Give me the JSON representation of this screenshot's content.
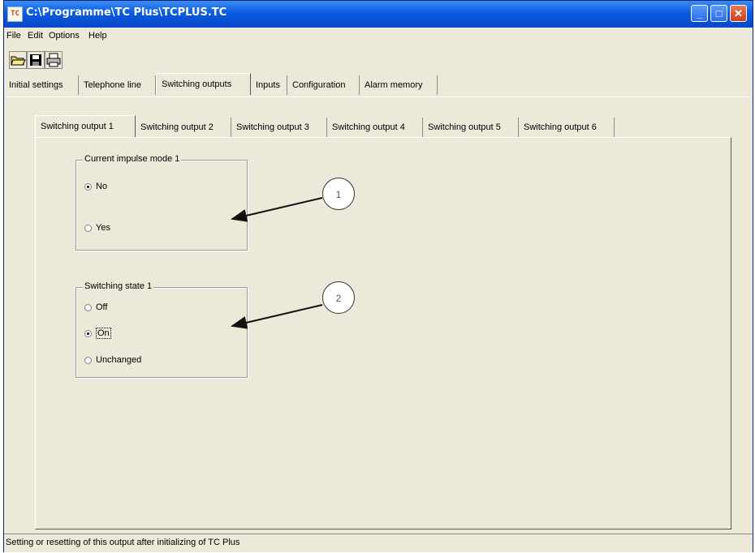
{
  "window": {
    "title": "C:\\Programme\\TC Plus\\TCPLUS.TC",
    "app_icon_text": "TC"
  },
  "window_buttons": {
    "minimize": "_",
    "maximize": "□",
    "close": "✕"
  },
  "menu": [
    "File",
    "Edit",
    "Options",
    "Help"
  ],
  "toolbar": {
    "icons": [
      "open-folder-icon",
      "save-disk-icon",
      "printer-icon"
    ]
  },
  "main_tabs": [
    "Initial settings",
    "Telephone line",
    "Switching outputs",
    "Inputs",
    "Configuration",
    "Alarm memory"
  ],
  "main_tab_active": "Switching outputs",
  "sub_tabs": [
    "Switching output 1",
    "Switching output 2",
    "Switching output 3",
    "Switching output 4",
    "Switching output 5",
    "Switching output 6"
  ],
  "sub_tab_active": "Switching output 1",
  "group1": {
    "title": "Current impulse mode 1",
    "options": [
      "No",
      "Yes"
    ],
    "selected": "No"
  },
  "group2": {
    "title": "Switching state 1",
    "options": [
      "Off",
      "On",
      "Unchanged"
    ],
    "selected": "On"
  },
  "callouts": [
    "1",
    "2"
  ],
  "status": "Setting or resetting of this output after initializing of TC Plus"
}
